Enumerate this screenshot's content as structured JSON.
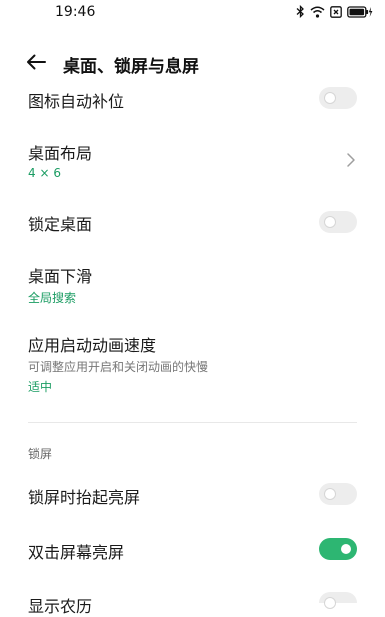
{
  "status_bar": {
    "time": "19:46",
    "icons": [
      "bluetooth-icon",
      "wifi-icon",
      "screenshot-icon",
      "battery-charging-icon"
    ]
  },
  "header": {
    "back_icon": "back-arrow-icon",
    "title": "桌面、锁屏与息屏"
  },
  "settings": {
    "icon_autofill": {
      "label": "图标自动补位",
      "enabled": false
    },
    "desktop_layout": {
      "label": "桌面布局",
      "value": "4 × 6"
    },
    "lock_desktop": {
      "label": "锁定桌面",
      "enabled": false
    },
    "swipe_down": {
      "label": "桌面下滑",
      "value": "全局搜索"
    },
    "animation_speed": {
      "label": "应用启动动画速度",
      "description": "可调整应用开启和关闭动画的快慢",
      "value": "适中"
    }
  },
  "lock_section": {
    "header": "锁屏",
    "raise_to_wake": {
      "label": "锁屏时抬起亮屏",
      "enabled": false
    },
    "double_tap_wake": {
      "label": "双击屏幕亮屏",
      "enabled": true
    },
    "show_calendar": {
      "label": "显示农历",
      "enabled": false
    }
  },
  "colors": {
    "accent": "#2db672",
    "subtitle_green": "#1a9c62",
    "toggle_off": "#ededed"
  }
}
